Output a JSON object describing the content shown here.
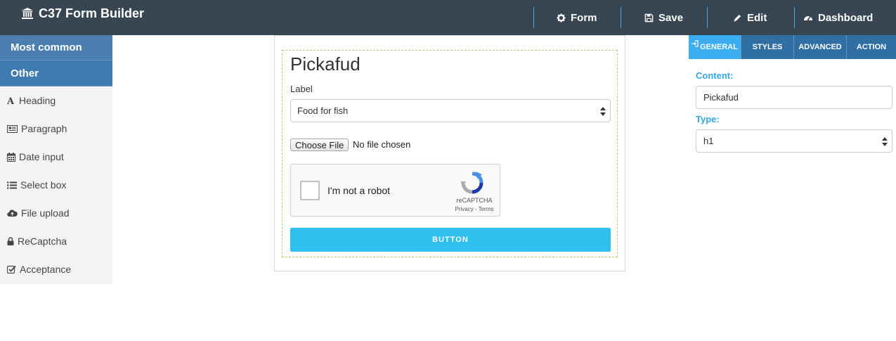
{
  "app": {
    "title": "C37 Form Builder"
  },
  "nav": {
    "form": "Form",
    "save": "Save",
    "edit": "Edit",
    "dashboard": "Dashboard"
  },
  "sidebar": {
    "categories": [
      "Most common",
      "Other"
    ],
    "items": [
      {
        "label": "Heading",
        "icon": "heading-icon"
      },
      {
        "label": "Paragraph",
        "icon": "paragraph-icon"
      },
      {
        "label": "Date input",
        "icon": "calendar-icon"
      },
      {
        "label": "Select box",
        "icon": "list-icon"
      },
      {
        "label": "File upload",
        "icon": "cloud-upload-icon"
      },
      {
        "label": "ReCaptcha",
        "icon": "lock-icon"
      },
      {
        "label": "Acceptance",
        "icon": "checkbox-icon"
      }
    ]
  },
  "form": {
    "title": "Pickafud",
    "label": "Label",
    "select_value": "Food for fish",
    "file_button": "Choose File",
    "file_status": "No file chosen",
    "captcha_text": "I'm not a robot",
    "captcha_brand": "reCAPTCHA",
    "captcha_links": "Privacy - Terms",
    "submit_label": "BUTTON"
  },
  "panel": {
    "tabs": [
      "GENERAL",
      "STYLES",
      "ADVANCED",
      "ACTION"
    ],
    "content_label": "Content:",
    "content_value": "Pickafud",
    "type_label": "Type:",
    "type_value": "h1"
  },
  "colors": {
    "topbar": "#384553",
    "category": "#4a7fb0",
    "accent": "#31bff0",
    "tab_active": "#3aaef0",
    "tab": "#2f6fa3",
    "label_blue": "#31a8e8"
  }
}
